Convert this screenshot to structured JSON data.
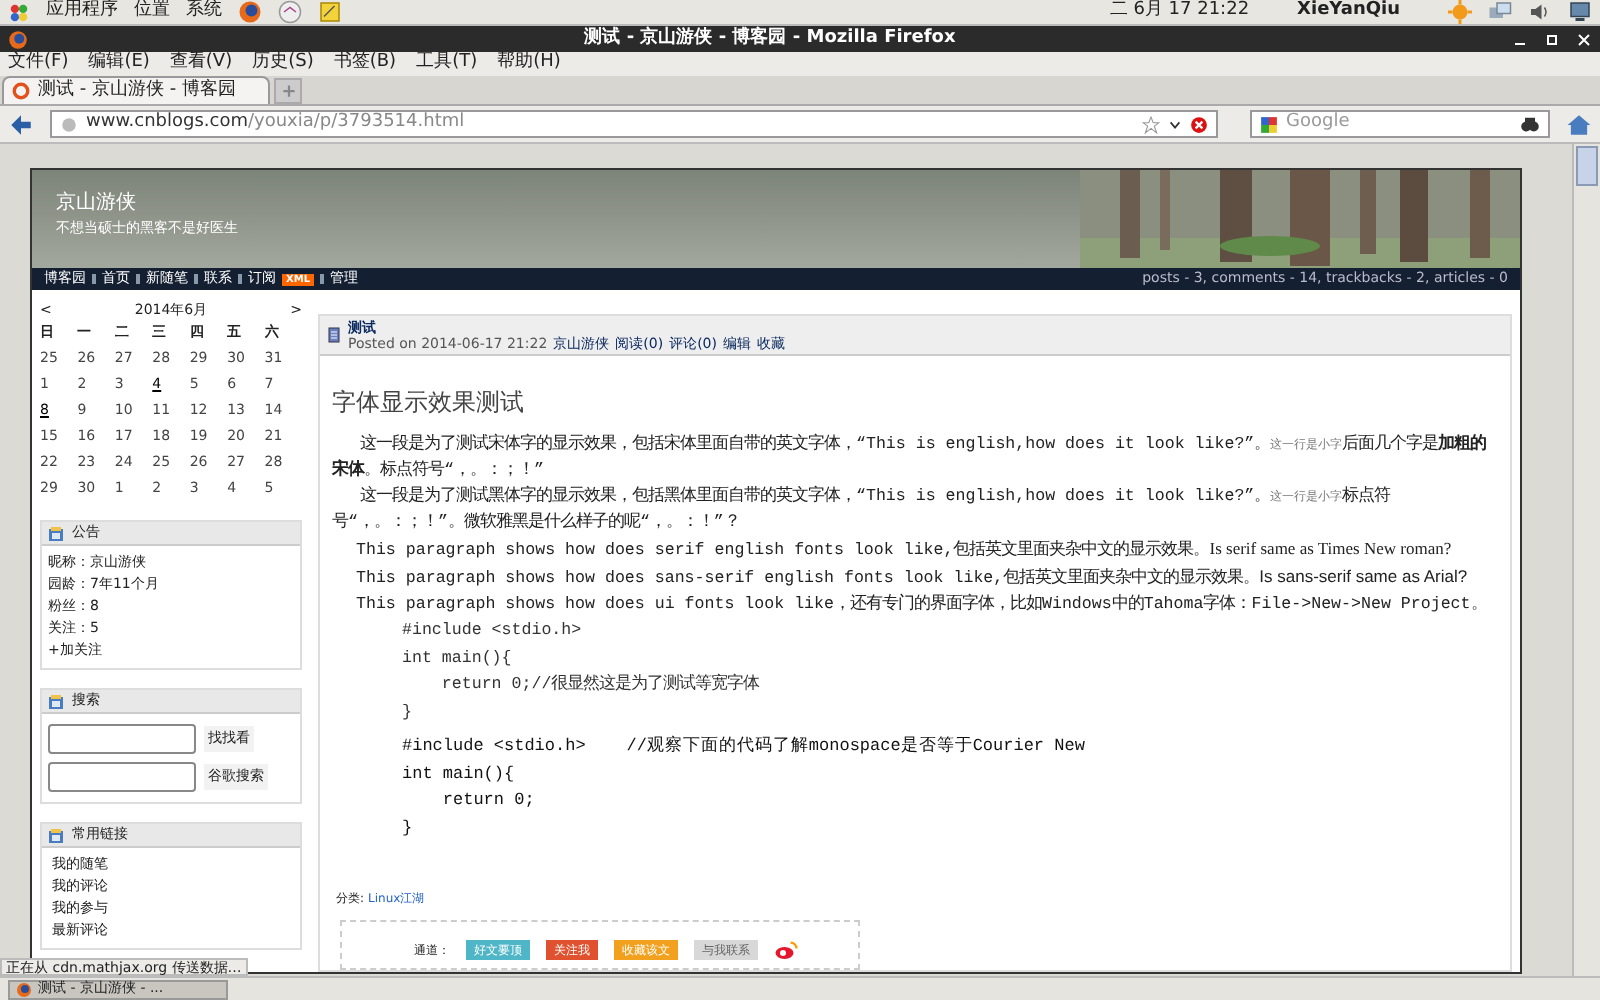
{
  "panel": {
    "menus": [
      "应用程序",
      "位置",
      "系统"
    ],
    "clock": "二 6月 17 21:22",
    "user": "XieYanQiu"
  },
  "window": {
    "title": "测试 - 京山游侠 - 博客园 - Mozilla Firefox"
  },
  "menubar": [
    "文件(F)",
    "编辑(E)",
    "查看(V)",
    "历史(S)",
    "书签(B)",
    "工具(T)",
    "帮助(H)"
  ],
  "tabs": [
    {
      "label": "测试 - 京山游侠 - 博客园",
      "selected": true
    }
  ],
  "address_bar": {
    "host": "www.cnblogs.com",
    "path": "/youxia/p/3793514.html",
    "search_placeholder": "Google"
  },
  "blog": {
    "title": "京山游侠",
    "subtitle": "不想当硕士的黑客不是好医生",
    "nav": [
      {
        "label": "博客园"
      },
      {
        "label": "首页"
      },
      {
        "label": "新随笔"
      },
      {
        "label": "联系"
      },
      {
        "label": "订阅",
        "badge": "XML"
      },
      {
        "label": "管理"
      }
    ],
    "stats": "posts - 3, comments - 14, trackbacks - 2, articles - 0"
  },
  "calendar": {
    "prev": "<",
    "month": "2014年6月",
    "next": ">",
    "weekdays": [
      "日",
      "一",
      "二",
      "三",
      "四",
      "五",
      "六"
    ],
    "weeks": [
      [
        {
          "day": "25",
          "linked": false
        },
        {
          "day": "26",
          "linked": false
        },
        {
          "day": "27",
          "linked": false
        },
        {
          "day": "28",
          "linked": false
        },
        {
          "day": "29",
          "linked": false
        },
        {
          "day": "30",
          "linked": false
        },
        {
          "day": "31",
          "linked": false
        }
      ],
      [
        {
          "day": "1",
          "linked": false
        },
        {
          "day": "2",
          "linked": false
        },
        {
          "day": "3",
          "linked": false
        },
        {
          "day": "4",
          "linked": true
        },
        {
          "day": "5",
          "linked": false
        },
        {
          "day": "6",
          "linked": false
        },
        {
          "day": "7",
          "linked": false
        }
      ],
      [
        {
          "day": "8",
          "linked": true
        },
        {
          "day": "9",
          "linked": false
        },
        {
          "day": "10",
          "linked": false
        },
        {
          "day": "11",
          "linked": false
        },
        {
          "day": "12",
          "linked": false
        },
        {
          "day": "13",
          "linked": false
        },
        {
          "day": "14",
          "linked": false
        }
      ],
      [
        {
          "day": "15",
          "linked": false
        },
        {
          "day": "16",
          "linked": false
        },
        {
          "day": "17",
          "linked": false
        },
        {
          "day": "18",
          "linked": false
        },
        {
          "day": "19",
          "linked": false
        },
        {
          "day": "20",
          "linked": false
        },
        {
          "day": "21",
          "linked": false
        }
      ],
      [
        {
          "day": "22",
          "linked": false
        },
        {
          "day": "23",
          "linked": false
        },
        {
          "day": "24",
          "linked": false
        },
        {
          "day": "25",
          "linked": false
        },
        {
          "day": "26",
          "linked": false
        },
        {
          "day": "27",
          "linked": false
        },
        {
          "day": "28",
          "linked": false
        }
      ],
      [
        {
          "day": "29",
          "linked": false
        },
        {
          "day": "30",
          "linked": false
        },
        {
          "day": "1",
          "linked": false
        },
        {
          "day": "2",
          "linked": false
        },
        {
          "day": "3",
          "linked": false
        },
        {
          "day": "4",
          "linked": false
        },
        {
          "day": "5",
          "linked": false
        }
      ]
    ]
  },
  "sidebar": [
    {
      "kind": "lines",
      "title": "公告",
      "lines": [
        "昵称：京山游侠",
        "园龄：7年11个月",
        "粉丝：8",
        "关注：5"
      ],
      "action": "+加关注"
    },
    {
      "kind": "search",
      "title": "搜索",
      "buttons": [
        "找找看",
        "谷歌搜索"
      ]
    },
    {
      "kind": "links",
      "title": "常用链接",
      "items": [
        "我的随笔",
        "我的评论",
        "我的参与",
        "最新评论"
      ]
    }
  ],
  "post": {
    "title": "测试",
    "posted": "Posted on 2014-06-17 21:22",
    "author": "京山游侠",
    "links": [
      "阅读(0)",
      "评论(0)",
      "编辑",
      "收藏"
    ],
    "heading": "字体显示效果测试",
    "paragraphs": [
      {
        "indent": true,
        "parts": [
          {
            "kind": "song",
            "text": "这一段是为了测试宋体字的显示效果，包括宋体里面自带的英文字体，“This is english,how does it look like?”。"
          },
          {
            "kind": "small",
            "text": "这一行是小字"
          },
          {
            "kind": "song",
            "text": "后面几个字是**加粗的宋体**。标点符号“，。：；！”"
          }
        ]
      },
      {
        "indent": true,
        "parts": [
          {
            "kind": "song",
            "text": "这一段是为了测试黑体字的显示效果，包括黑体里面自带的英文字体，“This is english,how does it look like?”。"
          },
          {
            "kind": "small",
            "text": "这一行是小字"
          },
          {
            "kind": "song",
            "text": "标点符号“，。：；！”。微软雅黑是什么样子的呢“，。：！”？"
          }
        ]
      },
      {
        "indent": false,
        "parts": [
          {
            "kind": "song",
            "text": "This paragraph shows how does serif english fonts look like,包括英文里面夹杂中文的显示效果。"
          },
          {
            "kind": "serif",
            "text": "Is serif same as Times New roman?"
          }
        ]
      },
      {
        "indent": false,
        "parts": [
          {
            "kind": "song",
            "text": "This paragraph shows how does sans-serif english fonts look like,包括英文里面夹杂中文的显示效果。"
          },
          {
            "kind": "sans",
            "text": "Is sans-serif same as Arial?"
          }
        ]
      },
      {
        "indent": false,
        "parts": [
          {
            "kind": "song",
            "text": "This paragraph shows how does ui fonts look like，还有专门的界面字体，比如Windows中的Tahoma字体：File->New->New Project。"
          }
        ]
      }
    ],
    "code_blocks": [
      {
        "kind": "song",
        "lines": [
          "#include <stdio.h>",
          "int main(){",
          "    return 0;//很显然这是为了测试等宽字体",
          "}"
        ]
      },
      {
        "kind": "mono",
        "lines": [
          "#include <stdio.h>    //观察下面的代码了解monospace是否等于Courier New",
          "int main(){",
          "    return 0;",
          "}"
        ]
      }
    ],
    "category_label": "分类:",
    "category": "Linux江湖",
    "share_label": "通道：",
    "share_buttons": [
      {
        "label": "好文要顶",
        "color": "#4fb6c8",
        "disabled": false
      },
      {
        "label": "关注我",
        "color": "#e0522f",
        "disabled": false
      },
      {
        "label": "收藏该文",
        "color": "#f2a11f",
        "disabled": false
      },
      {
        "label": "与我联系",
        "color": "#d8d8d8",
        "disabled": true
      }
    ]
  },
  "status_bar": "正在从 cdn.mathjax.org 传送数据…",
  "taskbar": [
    {
      "label": "测试 - 京山游侠 - ...",
      "selected": true
    }
  ]
}
